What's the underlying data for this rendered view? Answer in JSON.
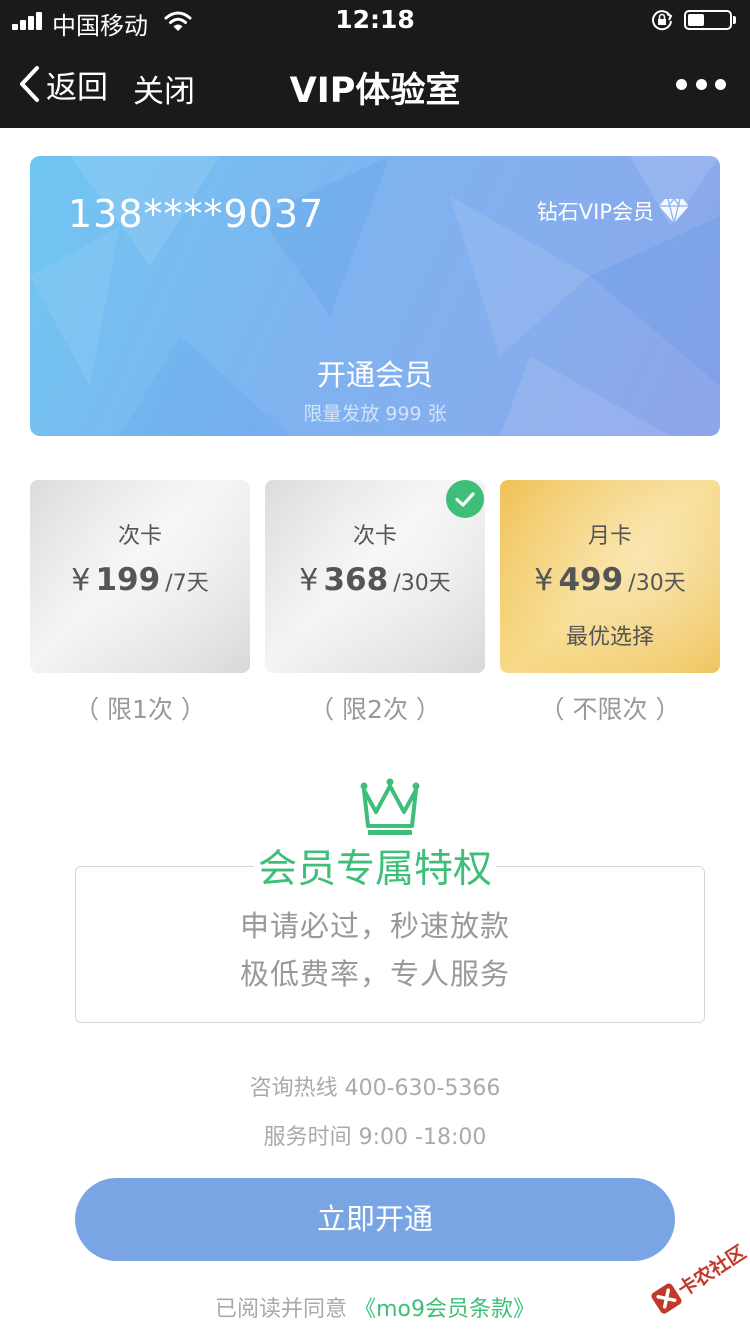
{
  "status_bar": {
    "carrier": "中国移动",
    "time": "12:18",
    "battery_level": 0.4
  },
  "nav": {
    "back_label": "返回",
    "close_label": "关闭",
    "title": "VIP体验室"
  },
  "hero": {
    "phone": "138****9037",
    "member_level": "钻石VIP会员",
    "open_label": "开通会员",
    "limit_text": "限量发放 999 张"
  },
  "plans": [
    {
      "name": "次卡",
      "currency": "¥",
      "price": "199",
      "period": "/7天",
      "limit": "（ 限1次 ）",
      "selected": false
    },
    {
      "name": "次卡",
      "currency": "¥",
      "price": "368",
      "period": "/30天",
      "limit": "（ 限2次 ）",
      "selected": true
    },
    {
      "name": "月卡",
      "currency": "¥",
      "price": "499",
      "period": "/30天",
      "badge": "最优选择",
      "limit": "（ 不限次 ）",
      "selected": false
    }
  ],
  "privileges": {
    "title": "会员专属特权",
    "line1": "申请必过，秒速放款",
    "line2": "极低费率，专人服务"
  },
  "contact": {
    "hotline": "咨询热线 400-630-5366",
    "hours": "服务时间 9:00 -18:00"
  },
  "cta_label": "立即开通",
  "agreement": {
    "prefix": "已阅读并同意",
    "terms": "《mo9会员条款》"
  },
  "watermark": "卡农社区",
  "colors": {
    "accent_green": "#3dbf7a",
    "cta_blue": "#79a5e4",
    "gold": "#f0c35a"
  }
}
